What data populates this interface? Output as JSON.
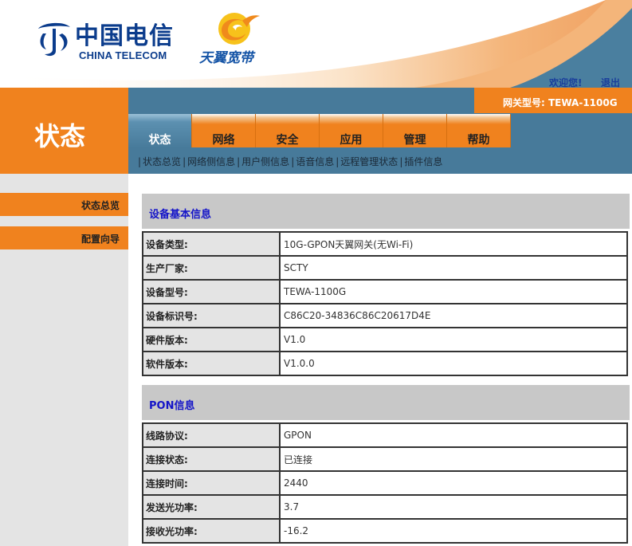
{
  "header": {
    "brand_cn": "中国电信",
    "brand_en": "CHINA TELECOM",
    "product_logo": "天翼宽带",
    "welcome": "欢迎您!",
    "logout": "退出",
    "gateway_model": "网关型号: TEWA-1100G"
  },
  "page_title": "状态",
  "tabs": [
    {
      "label": "状态",
      "active": true
    },
    {
      "label": "网络",
      "active": false
    },
    {
      "label": "安全",
      "active": false
    },
    {
      "label": "应用",
      "active": false
    },
    {
      "label": "管理",
      "active": false
    },
    {
      "label": "帮助",
      "active": false
    }
  ],
  "submenu": [
    "状态总览",
    "网络侧信息",
    "用户侧信息",
    "语音信息",
    "远程管理状态",
    "插件信息"
  ],
  "sidebar": {
    "items": [
      {
        "label": "状态总览"
      },
      {
        "label": "配置向导"
      }
    ]
  },
  "sections": [
    {
      "title": "设备基本信息",
      "rows": [
        {
          "key": "设备类型:",
          "value": "10G-GPON天翼网关(无Wi-Fi)"
        },
        {
          "key": "生产厂家:",
          "value": "SCTY"
        },
        {
          "key": "设备型号:",
          "value": "TEWA-1100G"
        },
        {
          "key": "设备标识号:",
          "value": "C86C20-34836C86C20617D4E"
        },
        {
          "key": "硬件版本:",
          "value": "V1.0"
        },
        {
          "key": "软件版本:",
          "value": "V1.0.0"
        }
      ]
    },
    {
      "title": "PON信息",
      "rows": [
        {
          "key": "线路协议:",
          "value": "GPON"
        },
        {
          "key": "连接状态:",
          "value": "已连接"
        },
        {
          "key": "连接时间:",
          "value": "2440"
        },
        {
          "key": "发送光功率:",
          "value": "3.7"
        },
        {
          "key": "接收光功率:",
          "value": "-16.2"
        }
      ]
    }
  ],
  "colors": {
    "orange": "#f0821e",
    "nav_blue": "#477a9a",
    "brand_blue": "#0b3c8c",
    "section_title": "#1414c8"
  }
}
